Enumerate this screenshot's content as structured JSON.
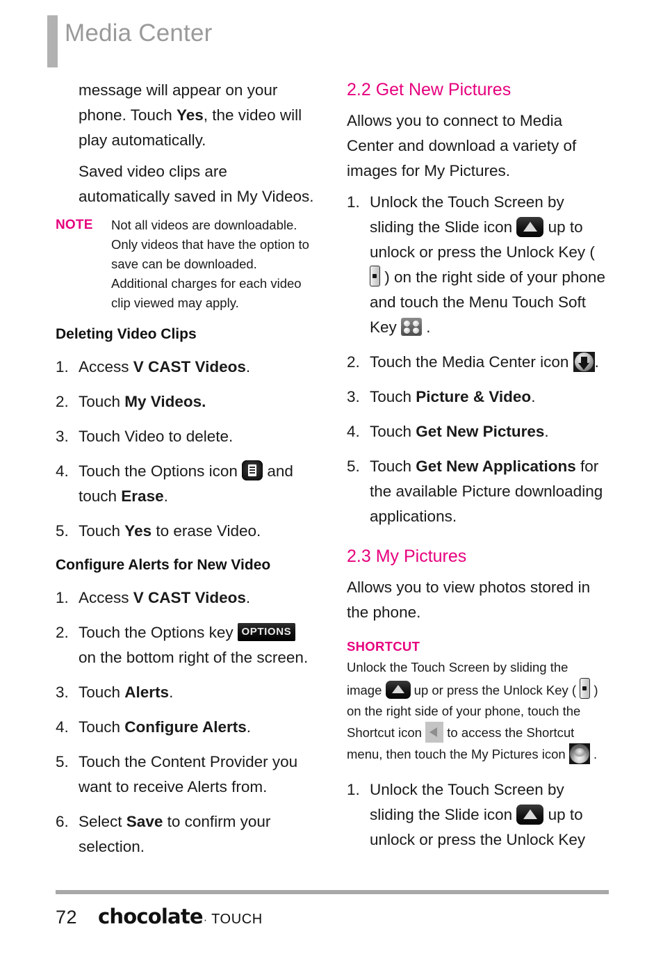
{
  "header": {
    "title": "Media Center"
  },
  "left_column": {
    "para_1_pre": "message will appear on your phone. Touch ",
    "para_1_bold": "Yes",
    "para_1_post": ", the video will play automatically.",
    "para_2": "Saved video clips are automatically saved in My Videos.",
    "note": {
      "label": "NOTE",
      "text": "Not all videos are downloadable. Only videos that have the option to save can be downloaded. Additional charges for each video clip viewed may apply."
    },
    "heading_deleting": "Deleting Video Clips",
    "deleting_steps": [
      {
        "num": "1.",
        "pre": "Access ",
        "bold": "V CAST Videos",
        "post": "."
      },
      {
        "num": "2.",
        "pre": "Touch ",
        "bold": "My Videos.",
        "post": ""
      },
      {
        "num": "3.",
        "pre": "Touch Video to delete.",
        "bold": "",
        "post": ""
      },
      {
        "num": "4.",
        "pre": "Touch the Options icon ",
        "icon": "options-icon",
        "mid": " and touch ",
        "bold": "Erase",
        "post": "."
      },
      {
        "num": "5.",
        "pre": "Touch ",
        "bold": "Yes",
        "post": " to erase Video."
      }
    ],
    "heading_configure": "Configure Alerts for New Video",
    "configure_steps": [
      {
        "num": "1.",
        "pre": "Access ",
        "bold": "V CAST Videos",
        "post": "."
      },
      {
        "num": "2.",
        "pre": "Touch the Options key ",
        "icon": "options-key",
        "icon_label": "OPTIONS",
        "post": " on the bottom right of the screen."
      },
      {
        "num": "3.",
        "pre": "Touch ",
        "bold": "Alerts",
        "post": "."
      },
      {
        "num": "4.",
        "pre": "Touch ",
        "bold": "Configure Alerts",
        "post": "."
      },
      {
        "num": "5.",
        "pre": "Touch the Content Provider you want to receive Alerts from.",
        "bold": "",
        "post": ""
      },
      {
        "num": "6.",
        "pre": "Select ",
        "bold": "Save",
        "post": " to confirm your selection."
      }
    ]
  },
  "right_column": {
    "section_2_2": {
      "heading": "2.2 Get New Pictures",
      "intro": "Allows you to connect to Media Center and download a variety of images for My Pictures.",
      "steps": [
        {
          "num": "1.",
          "s1": "Unlock the Touch Screen by sliding the Slide icon ",
          "s2": " up to unlock or press the Unlock Key ( ",
          "s3": " ) on the right side of your phone and touch the Menu Touch Soft Key ",
          "s4": " ."
        },
        {
          "num": "2.",
          "pre": "Touch the Media Center icon ",
          "post": "."
        },
        {
          "num": "3.",
          "pre": "Touch ",
          "bold": "Picture & Video",
          "post": "."
        },
        {
          "num": "4.",
          "pre": "Touch ",
          "bold": "Get New Pictures",
          "post": "."
        },
        {
          "num": "5.",
          "pre": "Touch ",
          "bold": "Get New Applications",
          "post": " for the available Picture downloading applications."
        }
      ]
    },
    "section_2_3": {
      "heading": "2.3 My Pictures",
      "intro": "Allows you to view photos stored in the phone.",
      "shortcut_label": "SHORTCUT",
      "shortcut": {
        "s1": "Unlock the Touch Screen by sliding the image ",
        "s2": " up or press the Unlock Key ( ",
        "s3": " ) on the right side of your phone, touch the Shortcut icon ",
        "s4": " to access the Shortcut menu, then touch the My Pictures icon ",
        "s5": " ."
      },
      "steps": [
        {
          "num": "1.",
          "s1": "Unlock the Touch Screen by sliding the Slide icon ",
          "s2": " up to unlock or press the Unlock Key"
        }
      ]
    }
  },
  "footer": {
    "page_number": "72",
    "brand_main": "chocolate",
    "brand_dot": "·",
    "brand_sub": "TOUCH"
  },
  "colors": {
    "accent_pink": "#e6007e",
    "header_gray": "#9a9a9a",
    "rule_gray": "#a8a8a8"
  }
}
